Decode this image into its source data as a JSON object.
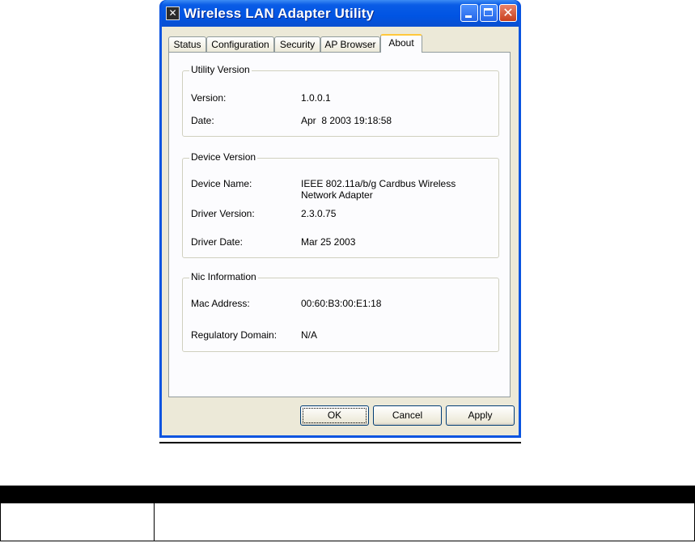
{
  "window": {
    "title": "Wireless LAN Adapter Utility",
    "icons": {
      "app": "network-adapter-icon",
      "minimize": "minimize-icon",
      "maximize": "maximize-icon",
      "close": "close-icon"
    }
  },
  "tabs": [
    {
      "label": "Status",
      "active": false
    },
    {
      "label": "Configuration",
      "active": false
    },
    {
      "label": "Security",
      "active": false
    },
    {
      "label": "AP Browser",
      "active": false
    },
    {
      "label": "About",
      "active": true
    }
  ],
  "utility_version": {
    "title": "Utility Version",
    "version_label": "Version:",
    "version_value": "1.0.0.1",
    "date_label": "Date:",
    "date_value": "Apr  8 2003 19:18:58"
  },
  "device_version": {
    "title": "Device Version",
    "device_name_label": "Device Name:",
    "device_name_value_line1": "IEEE 802.11a/b/g Cardbus Wireless",
    "device_name_value_line2": "Network Adapter",
    "driver_version_label": "Driver Version:",
    "driver_version_value": "2.3.0.75",
    "driver_date_label": "Driver Date:",
    "driver_date_value": "Mar 25 2003"
  },
  "nic_information": {
    "title": "Nic Information",
    "mac_label": "Mac Address:",
    "mac_value": "00:60:B3:00:E1:18",
    "reg_domain_label": "Regulatory Domain:",
    "reg_domain_value": "N/A"
  },
  "buttons": {
    "ok": "OK",
    "cancel": "Cancel",
    "apply": "Apply"
  },
  "colors": {
    "title_bar": "#0054e3",
    "dialog_bg": "#ece9d8",
    "panel_bg": "#fcfcfe",
    "active_tab_accent": "#ffc83c"
  }
}
